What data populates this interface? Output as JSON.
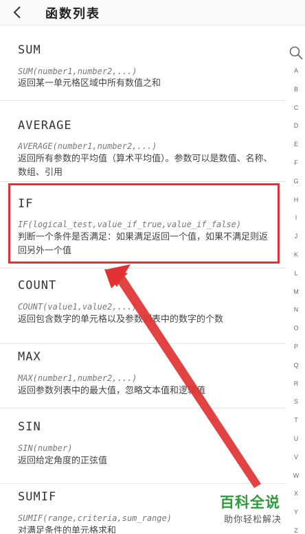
{
  "header": {
    "back_icon": "chevron-left-icon",
    "title": "函数列表"
  },
  "functions": [
    {
      "name": "SUM",
      "syntax": "SUM(number1,number2,...)",
      "description": "返回某一单元格区域中所有数值之和"
    },
    {
      "name": "AVERAGE",
      "syntax": "AVERAGE(number1,number2,...)",
      "description": "返回所有参数的平均值（算术平均值）。参数可以是数值、名称、数组、引用"
    },
    {
      "name": "IF",
      "syntax": "IF(logical_test,value_if_true,value_if_false)",
      "description": "判断一个条件是否满足：如果满足返回一个值，如果不满足则返回另外一个值"
    },
    {
      "name": "COUNT",
      "syntax": "COUNT(value1,value2,...)",
      "description": "返回包含数字的单元格以及参数列表中的数字的个数"
    },
    {
      "name": "MAX",
      "syntax": "MAX(number1,number2,...)",
      "description": "返回参数列表中的最大值，忽略文本值和逻辑值"
    },
    {
      "name": "SIN",
      "syntax": "SIN(number)",
      "description": "返回给定角度的正弦值"
    },
    {
      "name": "SUMIF",
      "syntax": "SUMIF(range,criteria,sum_range)",
      "description": "对满足条件的单元格求和"
    }
  ],
  "index_bar": {
    "search_icon": "search-icon",
    "letters": [
      "A",
      "B",
      "C",
      "D",
      "E",
      "F",
      "G",
      "H",
      "I",
      "J",
      "K",
      "L",
      "M",
      "N",
      "O",
      "P",
      "Q",
      "R",
      "S",
      "T",
      "U",
      "V",
      "W",
      "X",
      "Y",
      "Z"
    ]
  },
  "annotation": {
    "highlight_color": "#e03232",
    "arrow_color": "#e03232"
  },
  "watermark": {
    "title": "百科全说",
    "subtitle": "助你轻松解决"
  }
}
